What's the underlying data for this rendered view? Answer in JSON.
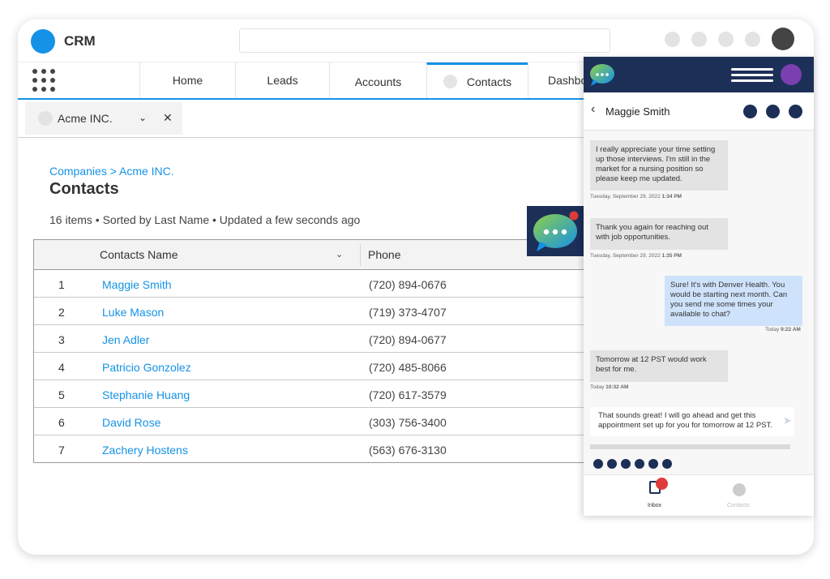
{
  "app": {
    "title": "CRM"
  },
  "nav": {
    "tabs": [
      {
        "label": "Home"
      },
      {
        "label": "Leads"
      },
      {
        "label": "Accounts"
      },
      {
        "label": "Contacts"
      },
      {
        "label": "Dashbo"
      }
    ]
  },
  "subtab": {
    "label": "Acme INC."
  },
  "breadcrumb": "Companies > Acme INC.",
  "page": {
    "title": "Contacts",
    "summary": "16 items • Sorted by Last Name • Updated a few seconds ago"
  },
  "table": {
    "columns": {
      "name": "Contacts Name",
      "phone": "Phone"
    },
    "rows": [
      {
        "num": "1",
        "name": "Maggie Smith",
        "phone": "(720) 894-0676"
      },
      {
        "num": "2",
        "name": "Luke Mason",
        "phone": "(719) 373-4707"
      },
      {
        "num": "3",
        "name": "Jen Adler",
        "phone": "(720) 894-0677"
      },
      {
        "num": "4",
        "name": "Patricio Gonzolez",
        "phone": "(720) 485-8066"
      },
      {
        "num": "5",
        "name": "Stephanie Huang",
        "phone": "(720) 617-3579"
      },
      {
        "num": "6",
        "name": "David Rose",
        "phone": "(303) 756-3400"
      },
      {
        "num": "7",
        "name": "Zachery Hostens",
        "phone": "(563) 676-3130"
      }
    ]
  },
  "chat": {
    "contact": "Maggie Smith",
    "messages": [
      {
        "dir": "in",
        "text": "I really appreciate your time setting up those interviews. I'm still in the market for a nursing position so please keep me updated.",
        "ts_date": "Tuesday, September 29, 2022 ",
        "ts_time": "1:34 PM"
      },
      {
        "dir": "in",
        "text": "Thank you again for reaching out with job opportunities.",
        "ts_date": "Tuesday, September 29, 2022 ",
        "ts_time": "1:35 PM"
      },
      {
        "dir": "out",
        "text": "Sure! It's with Denver Health. You would be starting next month. Can you send me some times your available to chat?",
        "ts_date": "Today ",
        "ts_time": "9:22 AM"
      },
      {
        "dir": "in",
        "text": "Tomorrow at 12 PST would work best for me.",
        "ts_date": "Today ",
        "ts_time": "10:32 AM"
      }
    ],
    "composer_text": "That sounds great! I will go ahead and get this appointment set up for you for tomorrow at 12 PST.",
    "footer": {
      "inbox": "Inbox",
      "contacts": "Contacts"
    }
  },
  "colors": {
    "accent": "#1592e6",
    "navy": "#1c2f57",
    "badge": "#e03b3b",
    "chat_in": "#e3e3e3",
    "chat_out": "#cfe2fb"
  },
  "icons": [
    "apps-grid-icon",
    "chevron-down-icon",
    "close-icon",
    "chat-bubble-icon",
    "menu-icon",
    "back-icon",
    "send-icon",
    "inbox-icon",
    "contacts-icon"
  ]
}
